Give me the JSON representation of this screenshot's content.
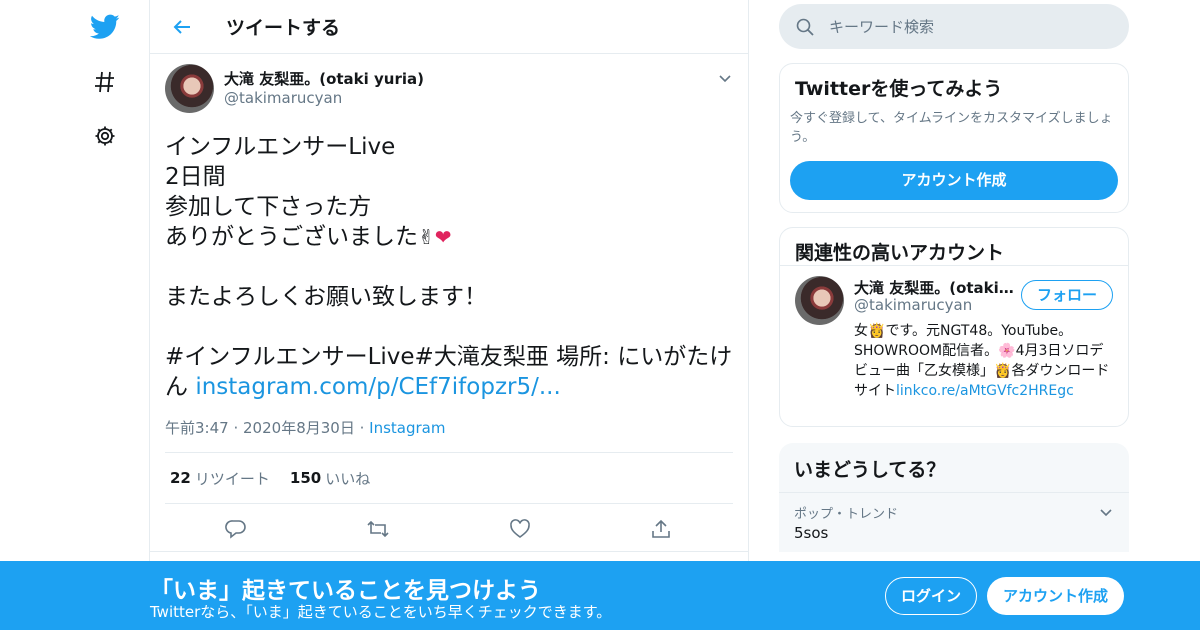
{
  "colors": {
    "brand": "#1da1f2",
    "link": "#1b95e0",
    "muted": "#657786"
  },
  "nav": {
    "icons": [
      "twitter-bird-icon",
      "hashtag-icon",
      "gear-icon"
    ]
  },
  "header": {
    "title": "ツイートする"
  },
  "tweet": {
    "author_name": "大滝 友梨亜。(otaki yuria)",
    "author_handle": "@takimarucyan",
    "line1": "インフルエンサーLive",
    "line2": "2日間",
    "line3": "参加して下さった方",
    "line4": "ありがとうございました",
    "line5": "またよろしくお願い致します！",
    "line6": "#インフルエンサーLive#大滝友梨亜 場所: にいがたけ",
    "line7_prefix": "ん ",
    "link": "instagram.com/p/CEf7ifopzr5/...",
    "time": "午前3:47",
    "date": "2020年8月30日",
    "source": "Instagram",
    "retweets": "22",
    "retweets_label": "リツイート",
    "likes": "150",
    "likes_label": "いいね"
  },
  "search": {
    "placeholder": "キーワード検索"
  },
  "signup_card": {
    "title": "Twitterを使ってみよう",
    "desc": "今すぐ登録して、タイムラインをカスタマイズしましょう。",
    "button": "アカウント作成"
  },
  "related": {
    "title": "関連性の高いアカウント",
    "name": "大滝 友梨亜。(otaki yuria)",
    "handle": "@takimarucyan",
    "follow": "フォロー",
    "bio_1": "女",
    "bio_2": "です。元NGT48。YouTube。SHOWROOM配信者。",
    "bio_3": "4月3日ソロデビュー曲「乙女模様」",
    "bio_4": "各ダウンロードサイト",
    "bio_link": "linkco.re/aMtGVfc2HREgc"
  },
  "trends": {
    "title": "いまどうしてる？",
    "items": [
      {
        "category": "ポップ・トレンド",
        "name": "5sos"
      }
    ]
  },
  "banner": {
    "title": "「いま」起きていることを見つけよう",
    "subtitle": "Twitterなら、「いま」起きていることをいち早くチェックできます。",
    "login": "ログイン",
    "signup": "アカウント作成"
  }
}
